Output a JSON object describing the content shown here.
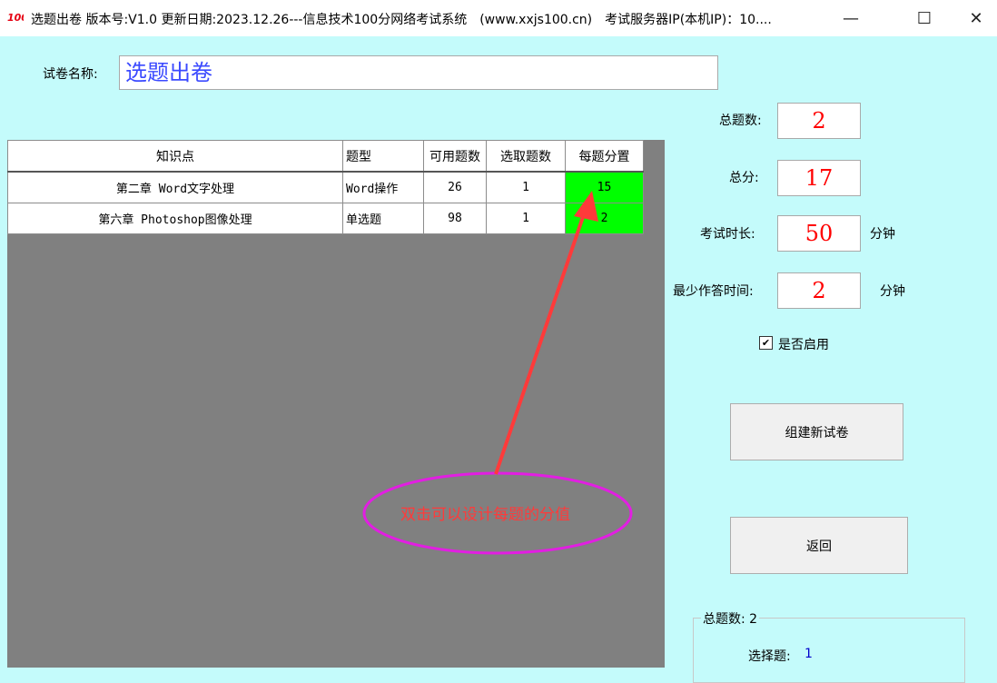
{
  "titlebar": {
    "title": "选题出卷 版本号:V1.0 更新日期:2023.12.26---信息技术100分网络考试系统　(www.xxjs100.cn)　考试服务器IP(本机IP)：10....",
    "icon_color": "#e60012"
  },
  "form": {
    "paper_name_label": "试卷名称:",
    "paper_name_value": "选题出卷"
  },
  "grid": {
    "headers": [
      "知识点",
      "题型",
      "可用题数",
      "选取题数",
      "每题分置"
    ],
    "rows": [
      {
        "topic": "第二章 Word文字处理",
        "type": "Word操作",
        "available": "26",
        "selected": "1",
        "score": "15"
      },
      {
        "topic": "第六章 Photoshop图像处理",
        "type": "单选题",
        "available": "98",
        "selected": "1",
        "score": "2"
      }
    ],
    "highlight_color": "#00ff00"
  },
  "side": {
    "total_questions_label": "总题数:",
    "total_questions_value": "2",
    "total_score_label": "总分:",
    "total_score_value": "17",
    "duration_label": "考试时长:",
    "duration_value": "50",
    "duration_unit": "分钟",
    "min_time_label": "最少作答时间:",
    "min_time_value": "2",
    "min_time_unit": "分钟",
    "enabled_label": "是否启用",
    "enabled_checked": true,
    "build_button": "组建新试卷",
    "back_button": "返回"
  },
  "summary": {
    "legend": "总题数: 2",
    "choice_label": "选择题:",
    "choice_value": "1"
  },
  "annotation": {
    "text": "双击可以设计每题的分值",
    "ellipse_color": "#e21ee2",
    "arrow_color": "#ff3a3a"
  }
}
